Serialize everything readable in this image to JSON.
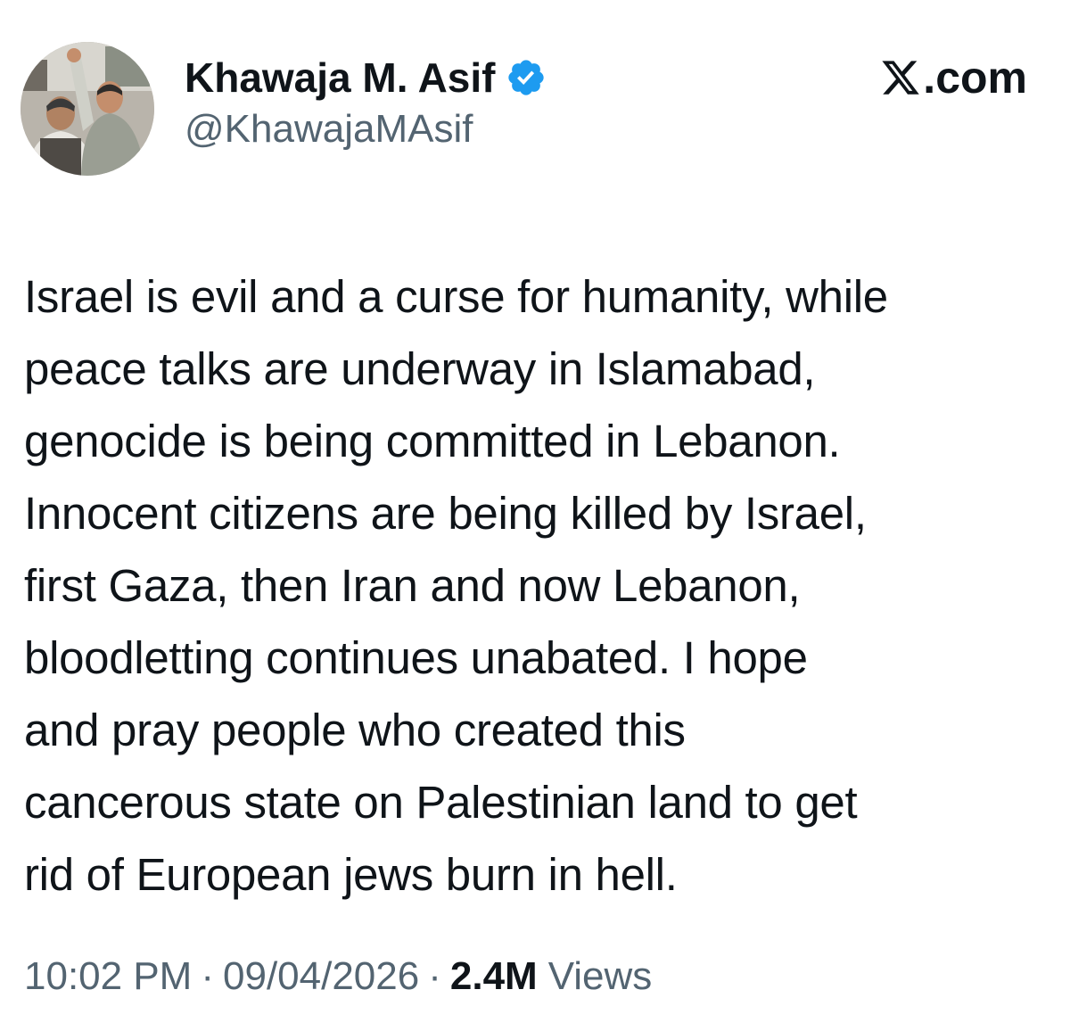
{
  "author": {
    "display_name": "Khawaja M. Asif",
    "handle": "@KhawajaMAsif",
    "verified_icon": "verified-badge-icon",
    "verified_color": "#1d9bf0",
    "avatar": "profile-photo"
  },
  "brand": {
    "label": ".com",
    "logo_icon": "x-logo-icon"
  },
  "tweet": {
    "text": "Israel is evil and a curse for humanity, while\npeace talks are underway in Islamabad,\ngenocide is being committed in Lebanon.\nInnocent citizens are being killed by Israel,\nfirst Gaza, then Iran and now Lebanon,\nbloodletting continues unabated. I hope\nand pray people who created this\ncancerous state on Palestinian land to get\nrid of European jews burn in hell."
  },
  "meta": {
    "time": "10:02 PM",
    "separator": "·",
    "date": "09/04/2026",
    "views_count": "2.4M",
    "views_label": "Views"
  },
  "colors": {
    "text_primary": "#0f1419",
    "text_secondary": "#536471",
    "background": "#ffffff"
  }
}
